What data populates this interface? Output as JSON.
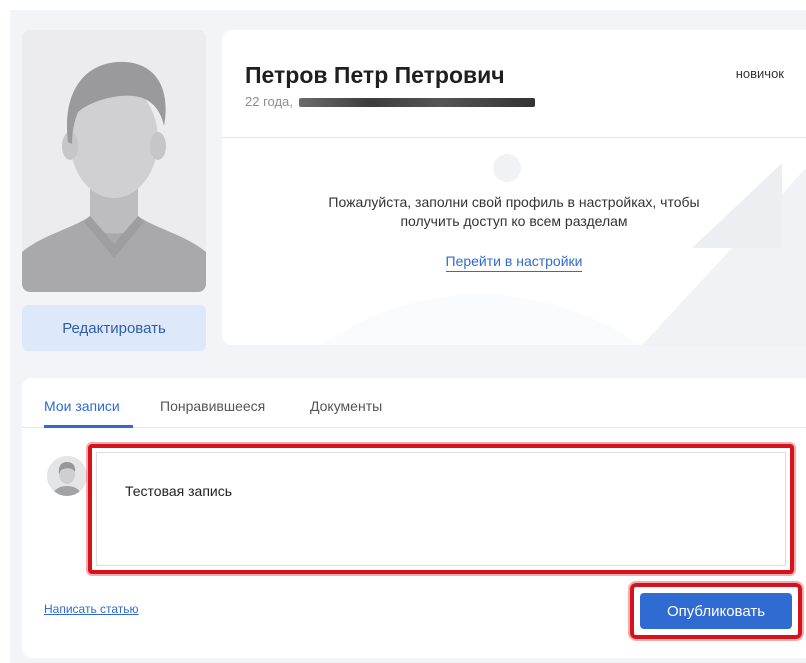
{
  "profile": {
    "name": "Петров Петр Петрович",
    "age_prefix": "22 года,",
    "rank": "новичок",
    "edit_label": "Редактировать"
  },
  "notice": {
    "line1": "Пожалуйста, заполни свой профиль в настройках, чтобы",
    "line2": "получить доступ ко всем разделам",
    "settings_link": "Перейти в настройки"
  },
  "tabs": [
    {
      "label": "Мои записи",
      "active": true
    },
    {
      "label": "Понравившееся",
      "active": false
    },
    {
      "label": "Документы",
      "active": false
    }
  ],
  "composer": {
    "text": "Тестовая запись",
    "write_article_label": "Написать статью",
    "publish_label": "Опубликовать"
  },
  "colors": {
    "accent": "#2f6bd1",
    "highlight": "#d6121c",
    "edit_button_bg": "#dde8fb"
  },
  "icons": {
    "avatar": "default-person-avatar-icon",
    "author": "small-person-avatar-icon"
  }
}
